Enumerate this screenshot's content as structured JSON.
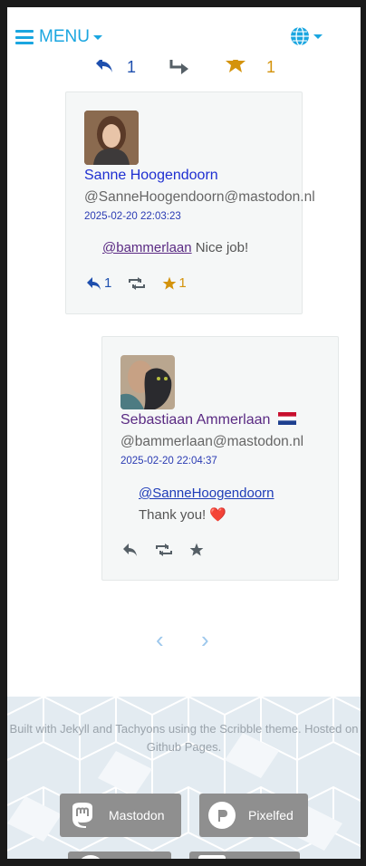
{
  "header": {
    "menu_label": "MENU",
    "icons": {
      "menu": "hamburger-icon",
      "language": "globe-icon"
    }
  },
  "top_actions": {
    "reply_count": "1",
    "fav_count": "1"
  },
  "comments": [
    {
      "name": "Sanne Hoogendoorn",
      "handle": "@SanneHoogendoorn@mastodon.nl",
      "date": "2025-02-20 22:03:23",
      "mention": "@bammerlaan",
      "text": " Nice job!",
      "reply_count": "1",
      "fav_count": "1",
      "name_color": "#1e2fd1"
    },
    {
      "name": "Sebastiaan Ammerlaan",
      "flag": "netherlands-flag",
      "handle": "@bammerlaan@mastodon.nl",
      "date": "2025-02-20 22:04:37",
      "mention": "@SanneHoogendoorn",
      "text": "Thank you!",
      "emoji": "❤️",
      "name_color": "#5a2a83"
    }
  ],
  "pager": {
    "prev": "‹",
    "next": "›"
  },
  "footer": {
    "text": "Built with Jekyll and Tachyons using the Scribble theme. Hosted on Github Pages.",
    "links": [
      "Mastodon",
      "Pixelfed"
    ]
  },
  "colors": {
    "accent": "#1aa6e0",
    "reply": "#1e4fae",
    "star": "#d4930b",
    "muted_icon": "#555f66"
  }
}
